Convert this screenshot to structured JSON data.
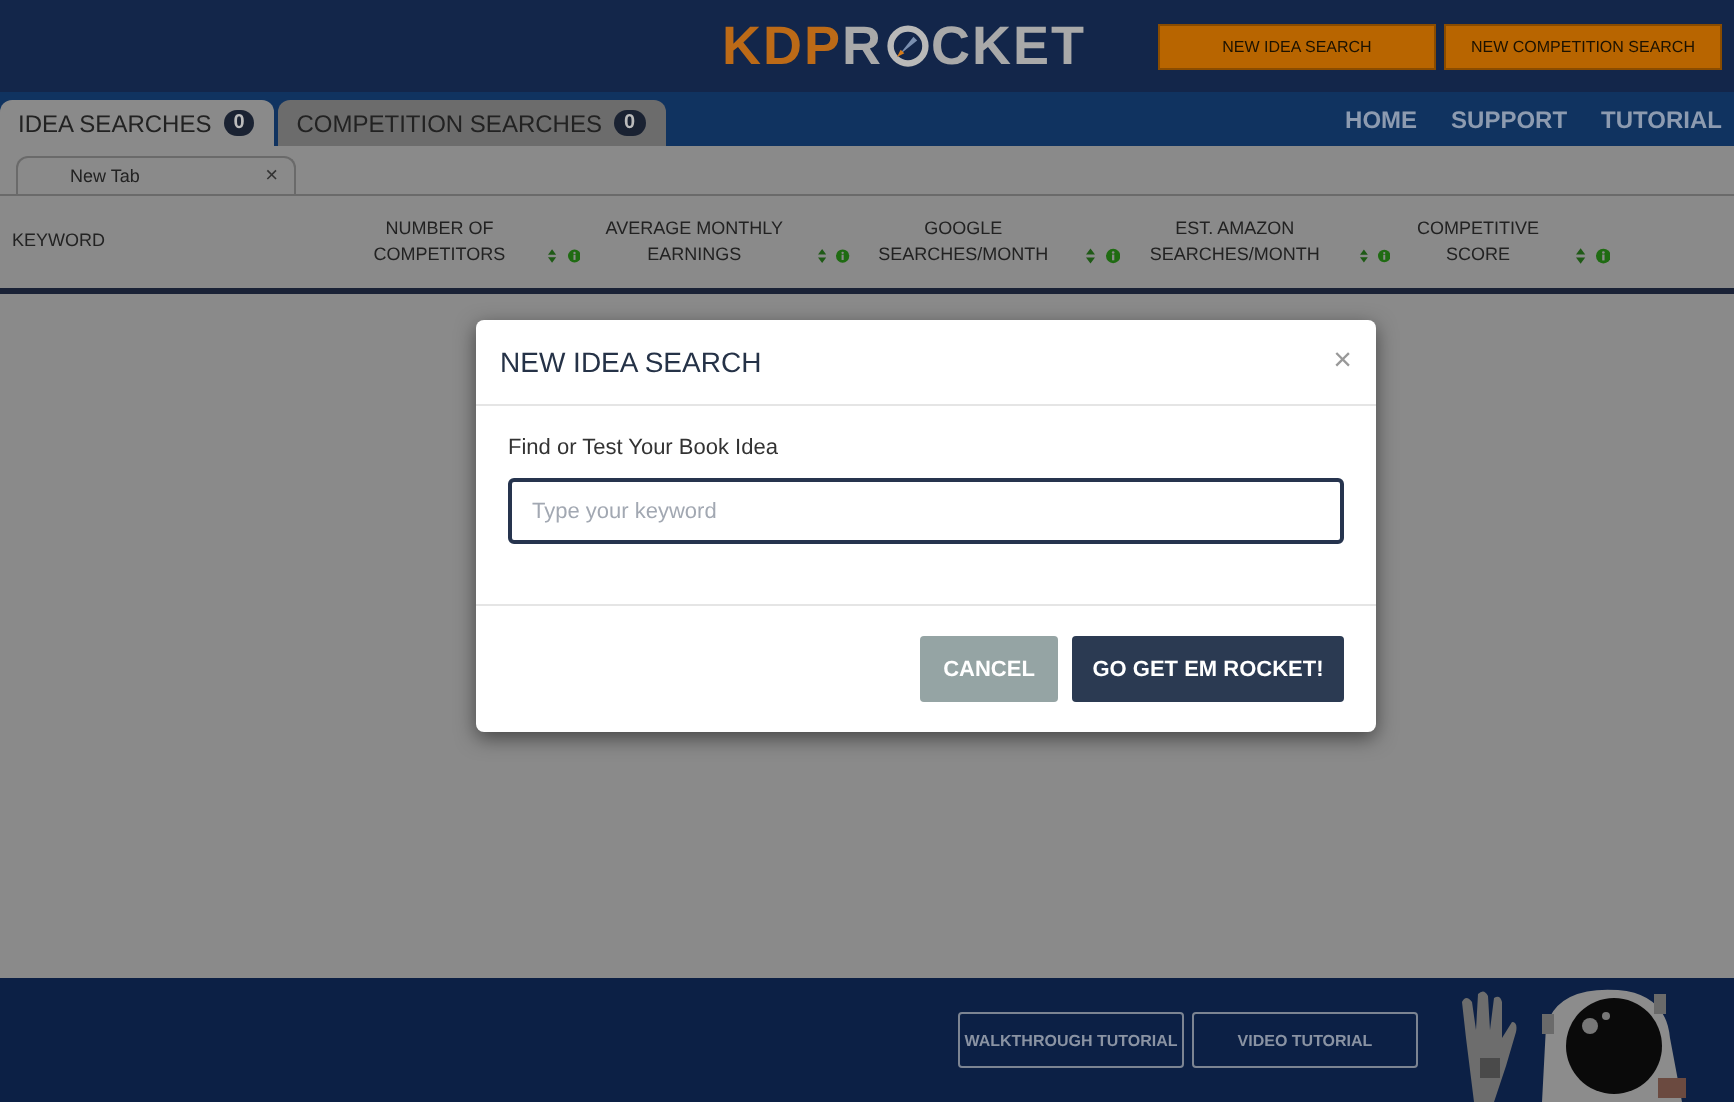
{
  "logo": {
    "part_1": "KDP",
    "part_2": "R",
    "part_3": "CKET"
  },
  "header_buttons": [
    "NEW IDEA SEARCH",
    "NEW COMPETITION SEARCH"
  ],
  "tabs": [
    {
      "label": "IDEA SEARCHES",
      "count": "0",
      "selected": true
    },
    {
      "label": "COMPETITION SEARCHES",
      "count": "0",
      "selected": false
    }
  ],
  "nav": [
    "HOME",
    "SUPPORT",
    "TUTORIAL"
  ],
  "subtabs": [
    {
      "label": "New Tab",
      "close": "×"
    }
  ],
  "table": {
    "columns": [
      {
        "label": "KEYWORD",
        "kind": "plain"
      },
      {
        "label": "NUMBER OF COMPETITORS",
        "kind": "sortable"
      },
      {
        "label": "AVERAGE MONTHLY EARNINGS",
        "kind": "sortable"
      },
      {
        "label": "GOOGLE SEARCHES/MONTH",
        "kind": "sortable"
      },
      {
        "label": "EST. AMAZON SEARCHES/MONTH",
        "kind": "sortable"
      },
      {
        "label": "COMPETITIVE SCORE",
        "kind": "sortable"
      }
    ]
  },
  "dialog": {
    "title": "NEW IDEA SEARCH",
    "close": "×",
    "label": "Find or Test Your Book Idea",
    "placeholder": "Type your keyword",
    "buttons": [
      {
        "label": "CANCEL",
        "kind": "secondary"
      },
      {
        "label": "GO GET EM ROCKET!",
        "kind": "primary"
      }
    ]
  },
  "footer_buttons": [
    "WALKTHROUGH TUTORIAL",
    "VIDEO TUTORIAL"
  ]
}
